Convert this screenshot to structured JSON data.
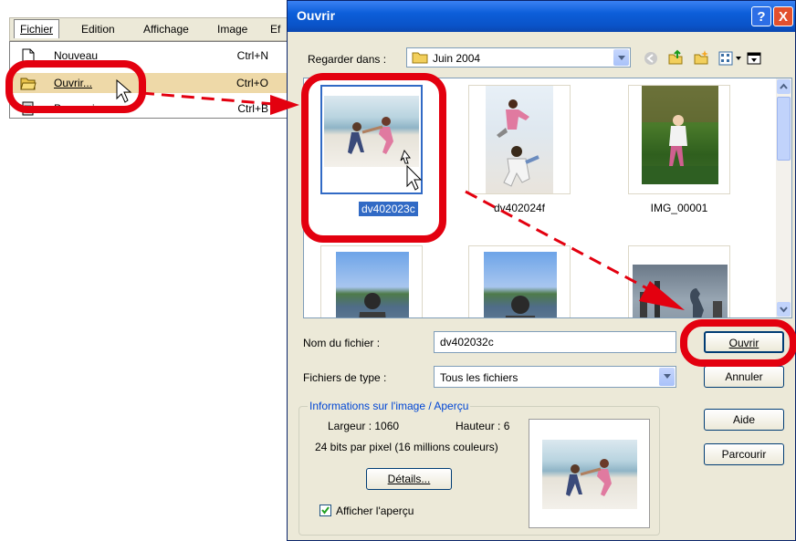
{
  "menu": {
    "bar": [
      "Fichier",
      "Edition",
      "Affichage",
      "Image",
      "Ef"
    ],
    "items": [
      {
        "label": "Nouveau",
        "shortcut": "Ctrl+N",
        "icon": "new-document-icon"
      },
      {
        "label": "Ouvrir...",
        "shortcut": "Ctrl+O",
        "icon": "open-folder-icon"
      },
      {
        "label": "Parcourir",
        "shortcut": "Ctrl+B",
        "icon": "browse-icon"
      }
    ]
  },
  "dialog": {
    "title": "Ouvrir",
    "title_buttons": [
      "?",
      "X"
    ],
    "look_in_label": "Regarder dans :",
    "look_in_value": "Juin 2004",
    "files": [
      {
        "name": "dv402023c",
        "selected": true
      },
      {
        "name": "dv402024f",
        "selected": false
      },
      {
        "name": "IMG_00001",
        "selected": false
      },
      {
        "name": "",
        "selected": false
      },
      {
        "name": "",
        "selected": false
      },
      {
        "name": "",
        "selected": false
      }
    ],
    "filename_label": "Nom du fichier :",
    "filename_value": "dv402032c",
    "filetype_label": "Fichiers de type :",
    "filetype_value": "Tous les fichiers",
    "info_group": "Informations sur l'image / Aperçu",
    "width_text": "Largeur : 1060",
    "height_text": "Hauteur : 6",
    "depth_text": "24 bits par pixel (16 millions couleurs)",
    "details_button": "Détails...",
    "preview_checkbox": "Afficher l'aperçu",
    "preview_checked": true,
    "buttons": {
      "open": "Ouvrir",
      "cancel": "Annuler",
      "help": "Aide",
      "browse": "Parcourir"
    }
  },
  "colors": {
    "annotation_red": "#e3000f",
    "selection": "#316ac5",
    "menu_highlight": "#eed9a8"
  }
}
